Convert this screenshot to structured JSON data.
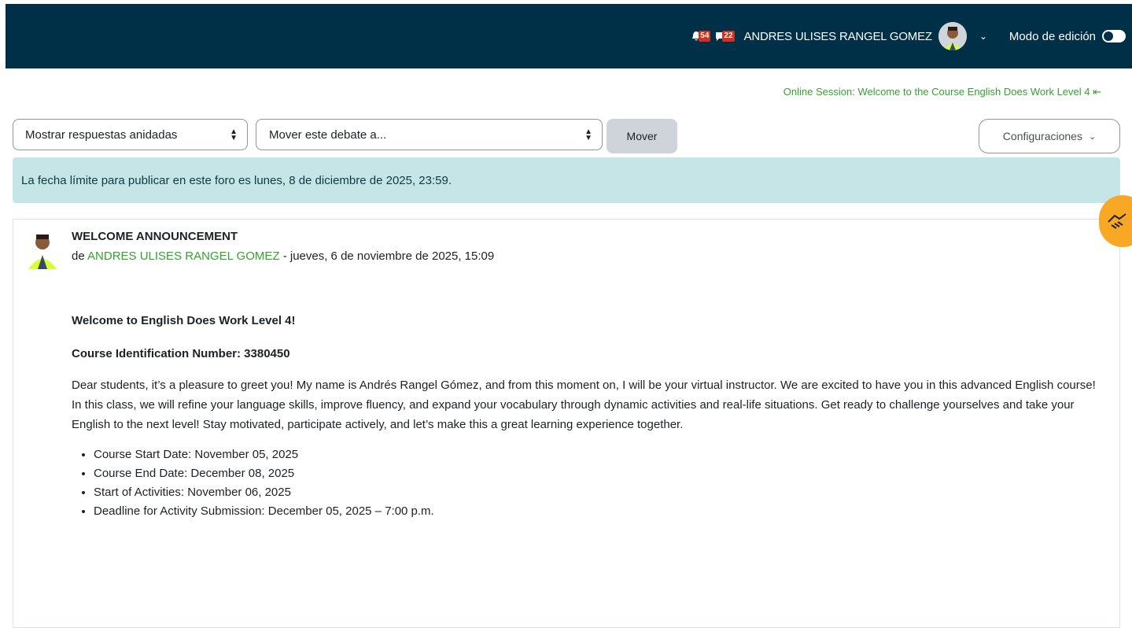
{
  "header": {
    "notifications_count": "54",
    "messages_count": "22",
    "user_name": "ANDRES ULISES RANGEL GOMEZ",
    "edit_mode_label": "Modo de edición",
    "edit_mode_on": false
  },
  "nav": {
    "prev_link": "Online Session: Welcome to the Course English Does Work Level 4 ⇤"
  },
  "controls": {
    "display_mode": "Mostrar respuestas anidadas",
    "move_select_placeholder": "Mover este debate a...",
    "move_button": "Mover",
    "settings_button": "Configuraciones"
  },
  "alert": {
    "text": "La fecha límite para publicar en este foro es lunes, 8 de diciembre de 2025, 23:59."
  },
  "post": {
    "title": "WELCOME ANNOUNCEMENT",
    "by_prefix": "de ",
    "author": "ANDRES ULISES RANGEL GOMEZ",
    "date": " - jueves, 6 de noviembre de 2025, 15:09",
    "heading1": "Welcome to English Does Work Level 4!",
    "heading2": "Course Identification Number: 3380450",
    "paragraph": "Dear students, it’s a pleasure to greet you! My name is Andrés Rangel Gómez, and from this moment on, I will be your virtual instructor. We are excited to have you in this advanced English course! In this class, we will refine your language skills, improve fluency, and expand your vocabulary through dynamic activities and real-life situations. Get ready to challenge yourselves and take your English to the next level!  Stay motivated, participate actively, and let’s make this a great learning experience together.",
    "list": [
      "Course Start Date: November 05, 2025",
      "Course End Date: December 08, 2025",
      "Start of Activities: November 06, 2025",
      "Deadline for Activity Submission: December 05, 2025 – 7:00 p.m."
    ]
  },
  "colors": {
    "header_bg": "#003047",
    "link_green": "#35a22f",
    "alert_bg": "#c6e5e7",
    "badge_red": "#d1301f",
    "fab": "#f9a825"
  }
}
